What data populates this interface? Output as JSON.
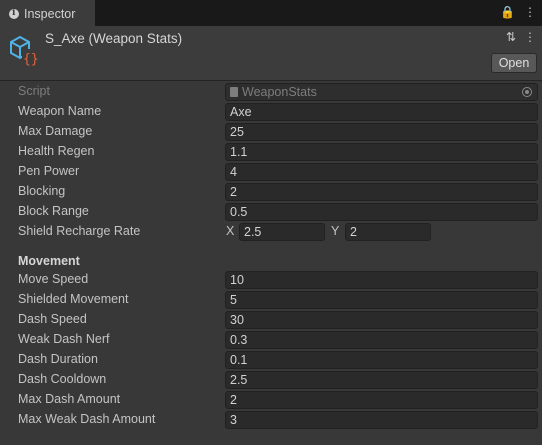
{
  "tab": {
    "title": "Inspector"
  },
  "header": {
    "asset_title": "S_Axe (Weapon Stats)",
    "open_label": "Open"
  },
  "script_row": {
    "label": "Script",
    "value": "WeaponStats"
  },
  "fields": [
    {
      "label": "Weapon Name",
      "value": "Axe"
    },
    {
      "label": "Max Damage",
      "value": "25"
    },
    {
      "label": "Health Regen",
      "value": "1.1"
    },
    {
      "label": "Pen Power",
      "value": "4"
    },
    {
      "label": "Blocking",
      "value": "2"
    },
    {
      "label": "Block Range",
      "value": "0.5"
    }
  ],
  "shield_recharge": {
    "label": "Shield Recharge Rate",
    "x_label": "X",
    "x": "2.5",
    "y_label": "Y",
    "y": "2"
  },
  "movement": {
    "header": "Movement",
    "fields": [
      {
        "label": "Move Speed",
        "value": "10"
      },
      {
        "label": "Shielded Movement",
        "value": "5"
      },
      {
        "label": "Dash Speed",
        "value": "30"
      },
      {
        "label": "Weak Dash Nerf",
        "value": "0.3"
      },
      {
        "label": "Dash Duration",
        "value": "0.1"
      },
      {
        "label": "Dash Cooldown",
        "value": "2.5"
      },
      {
        "label": "Max Dash Amount",
        "value": "2"
      },
      {
        "label": "Max Weak Dash Amount",
        "value": "3"
      }
    ]
  },
  "colors": {
    "background": "#383838",
    "field": "#2a2a2a",
    "icon_accent": "#e8623a",
    "icon_outline": "#4fb3e8"
  }
}
